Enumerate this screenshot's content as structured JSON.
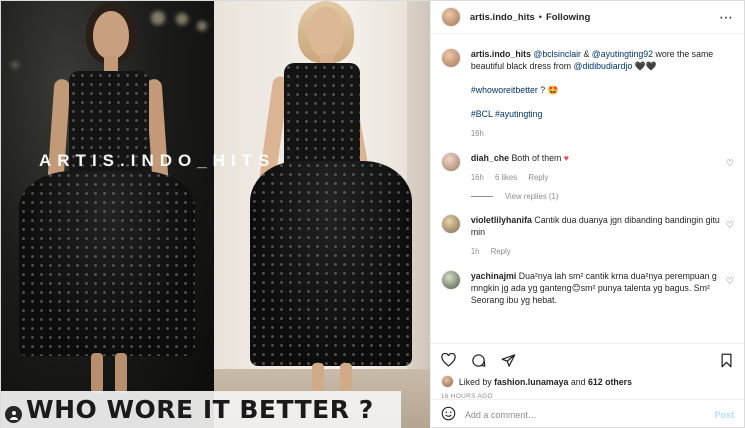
{
  "post": {
    "watermark": "ARTIS.INDO_HITS",
    "banner": "WHO WORE IT BETTER ?"
  },
  "header": {
    "username": "artis.indo_hits",
    "separator": "•",
    "follow_label": "Following",
    "more_icon": "more-horizontal-icon"
  },
  "caption": {
    "username": "artis.indo_hits",
    "mention1": "@bclsinclair",
    "amp": "&",
    "mention2": "@ayutingting92",
    "text": "wore the same beautiful black dress from",
    "mention3": "@didibudiardjo",
    "hearts": "🖤🖤",
    "hashtag1": "#whoworeitbetter",
    "hashtag1_suffix": "? 🤩",
    "hashtag2": "#BCL",
    "hashtag3": "#ayutingting",
    "time": "16h"
  },
  "comments": [
    {
      "username": "diah_che",
      "text": "Both of them",
      "emoji": "♥",
      "time": "16h",
      "likes": "6 likes",
      "reply": "Reply",
      "view_replies": "View replies (1)"
    },
    {
      "username": "violetlilyhanifa",
      "text": "Cantik dua duanya jgn dibanding bandingin gitu min",
      "time": "1h",
      "reply": "Reply"
    },
    {
      "username": "yachinajmi",
      "text": "Dua²nya lah sm² cantik krna dua²nya perempuan g mngkin jg ada yg ganteng😊sm² punya talenta yg bagus. Sm² Seorang ibu yg hebat."
    }
  ],
  "likes": {
    "prefix": "Liked by",
    "user": "fashion.lunamaya",
    "and": "and",
    "others": "612 others"
  },
  "timestamp": "16 HOURS AGO",
  "composer": {
    "placeholder": "Add a comment…",
    "post_label": "Post"
  },
  "colors": {
    "link": "#00376b",
    "muted": "#8e8e8e",
    "heart": "#ed4956",
    "post_disabled": "#b2dffc"
  }
}
